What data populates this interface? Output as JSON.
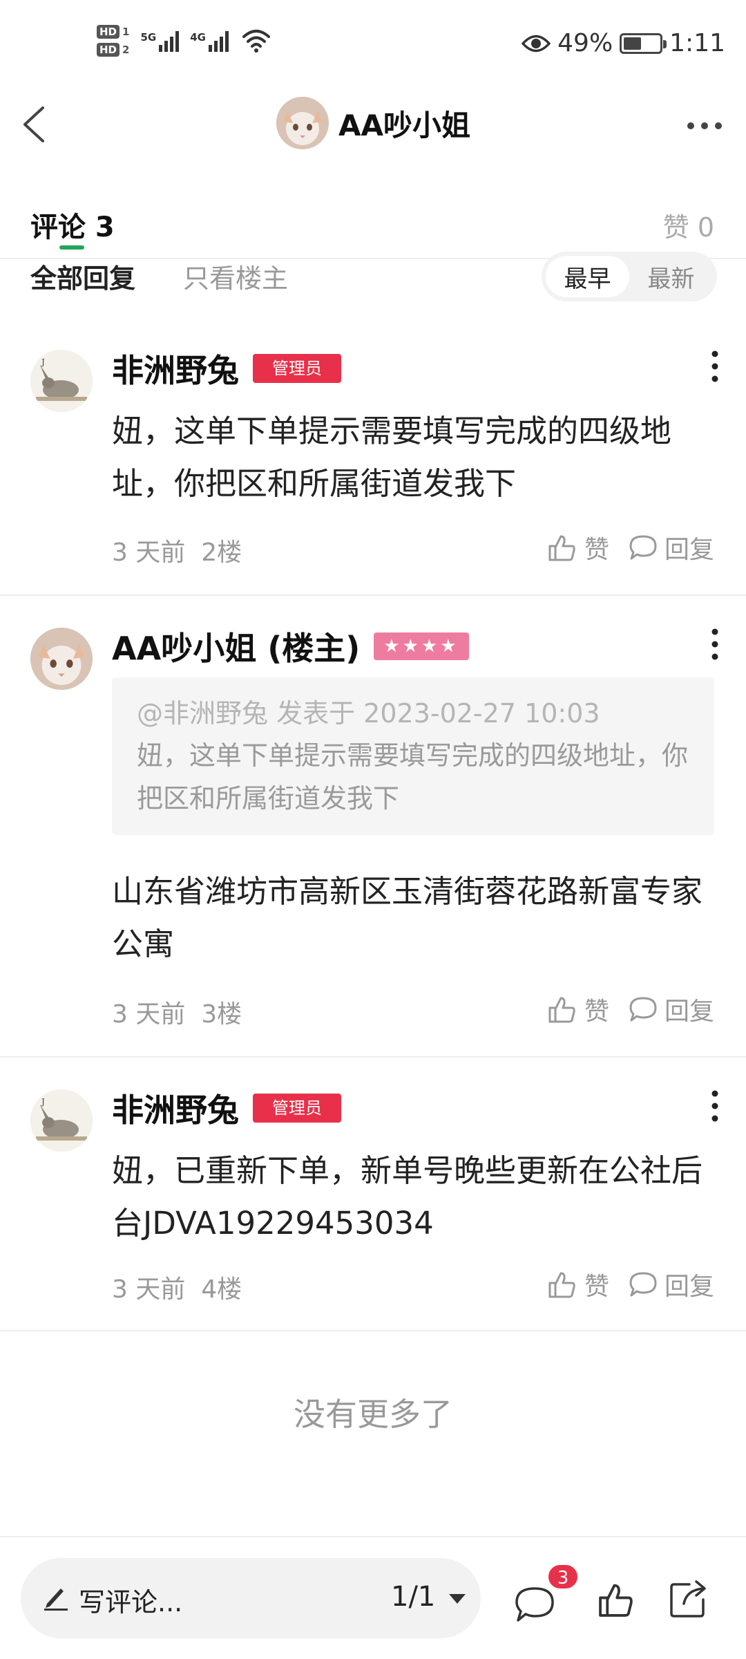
{
  "status_bar": {
    "hd1": "HD",
    "hd1_num": "1",
    "hd2": "HD",
    "hd2_num": "2",
    "signal1": "5G",
    "signal2": "4G",
    "battery": "49%",
    "battery_level": 0.49,
    "time": "1:11"
  },
  "header": {
    "title": "AA吵小姐"
  },
  "tabs": {
    "comments": "评论 3",
    "likes": "赞 0"
  },
  "filter": {
    "all": "全部回复",
    "owner_only": "只看楼主",
    "sort": [
      {
        "label": "最早",
        "active": true
      },
      {
        "label": "最新",
        "active": false
      }
    ]
  },
  "comments": [
    {
      "name": "非洲野兔",
      "badge": "管理员",
      "text": "妞，这单下单提示需要填写完成的四级地址，你把区和所属街道发我下",
      "time": "3 天前",
      "floor": "2楼",
      "like": "赞",
      "reply": "回复"
    },
    {
      "name": "AA吵小姐 (楼主)",
      "badge": "★★★★",
      "quote_head": "@非洲野兔  发表于 2023-02-27 10:03",
      "quote_body": "妞，这单下单提示需要填写完成的四级地址，你把区和所属街道发我下",
      "text": "山东省潍坊市高新区玉清街蓉花路新富专家公寓",
      "time": "3 天前",
      "floor": "3楼",
      "like": "赞",
      "reply": "回复"
    },
    {
      "name": "非洲野兔",
      "badge": "管理员",
      "text": "妞，已重新下单，新单号晚些更新在公社后台JDVA19229453034",
      "time": "3 天前",
      "floor": "4楼",
      "like": "赞",
      "reply": "回复"
    }
  ],
  "no_more": "没有更多了",
  "bottom_bar": {
    "compose_placeholder": "写评论...",
    "page_indicator": "1/1",
    "comment_count": "3"
  },
  "colors": {
    "accent_green": "#22a55a",
    "admin_red": "#e8304a",
    "owner_pink": "#ee7ca0"
  }
}
